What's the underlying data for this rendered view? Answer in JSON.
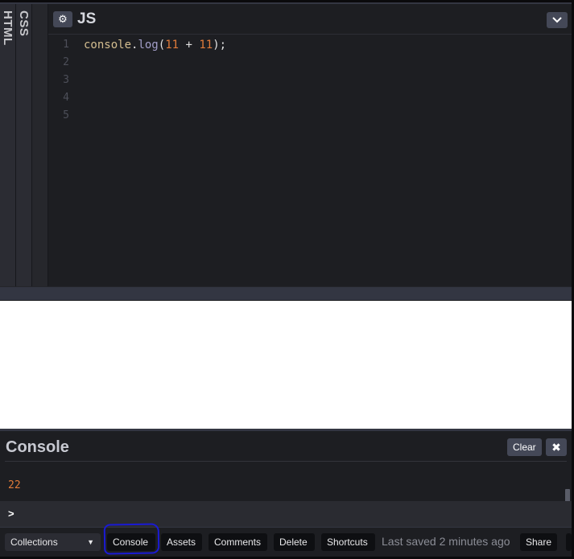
{
  "panes": {
    "html_label": "HTML",
    "css_label": "CSS",
    "js_title": "JS"
  },
  "icons": {
    "settings": "gear-icon",
    "collapse": "chevron-down-icon",
    "close": "close-icon",
    "prompt": "chevron-right-icon"
  },
  "editor": {
    "line_numbers": [
      "1",
      "2",
      "3",
      "4",
      "5"
    ],
    "code": {
      "ident": "console",
      "dot": ".",
      "method": "log",
      "open": "(",
      "arg1": "11",
      "op": " + ",
      "arg2": "11",
      "close": ");"
    }
  },
  "console": {
    "title": "Console",
    "clear_label": "Clear",
    "close_glyph": "✖",
    "output": "22",
    "prompt": ">"
  },
  "footer": {
    "collections_label": "Collections",
    "collections_caret": "▼",
    "console_label": "Console",
    "assets_label": "Assets",
    "comments_label": "Comments",
    "delete_label": "Delete",
    "shortcuts_label": "Shortcuts",
    "last_saved": "Last saved 2 minutes ago",
    "share_label": "Share"
  },
  "colors": {
    "background": "#1d1e22",
    "button": "#444857",
    "number_token": "#e07b3a",
    "highlight_annotation": "#1a1ad4"
  }
}
